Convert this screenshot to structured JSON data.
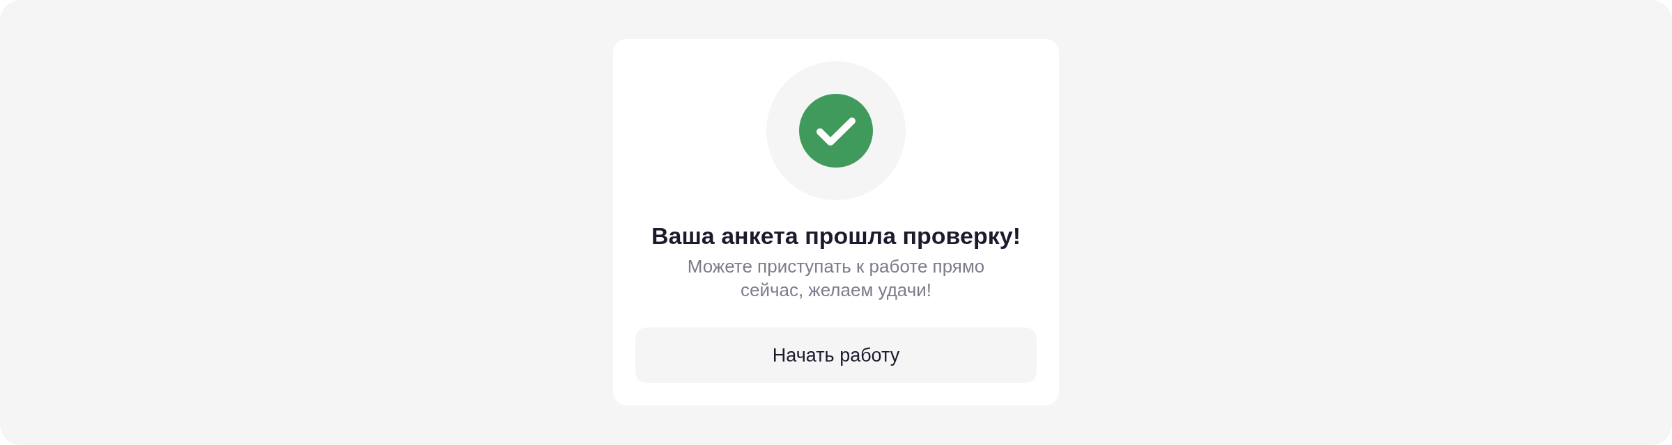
{
  "card": {
    "title": "Ваша анкета прошла проверку!",
    "message": "Можете приступать к работе прямо сейчас, желаем удачи!",
    "button": {
      "label": "Начать работу"
    }
  }
}
